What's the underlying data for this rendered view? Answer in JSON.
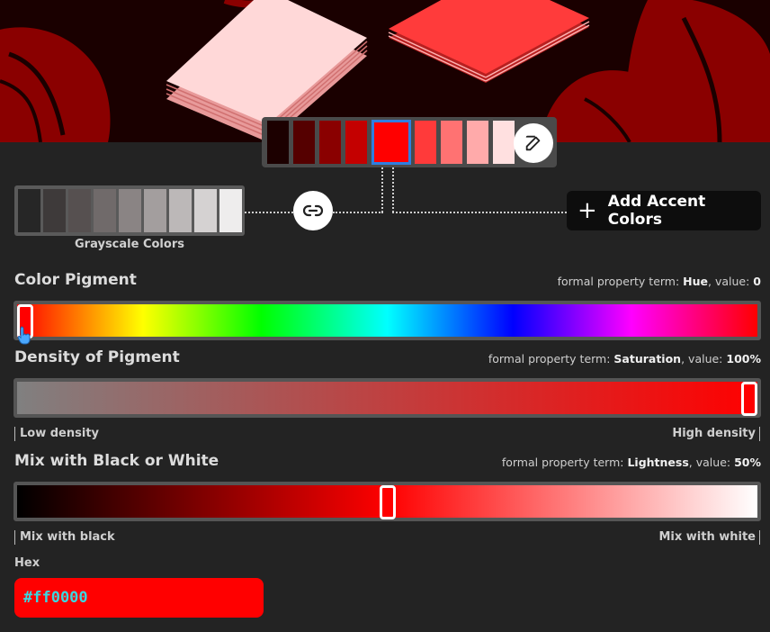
{
  "palette": {
    "swatches": [
      "#1c0000",
      "#550000",
      "#8a0000",
      "#c40000",
      "#ff0000",
      "#ff3a3a",
      "#ff7272",
      "#ffaaaa",
      "#ffe0e0"
    ],
    "selected_index": 4
  },
  "grayscale": {
    "label": "Grayscale Colors",
    "swatches": [
      "#262626",
      "#3e3a3a",
      "#565050",
      "#706a6a",
      "#8a8484",
      "#a39e9e",
      "#bcb8b8",
      "#d5d2d2",
      "#eeeded"
    ]
  },
  "accent_button": {
    "label": "Add Accent Colors"
  },
  "hue": {
    "title": "Color Pigment",
    "term_prefix": "formal property term: ",
    "term_name": "Hue",
    "value_sep": ", value: ",
    "value": "0",
    "level": 0
  },
  "saturation": {
    "title": "Density of Pigment",
    "term_prefix": "formal property term: ",
    "term_name": "Saturation",
    "value_sep": ", value: ",
    "value": "100%",
    "level": 1,
    "low_label": "Low density",
    "high_label": "High density"
  },
  "lightness": {
    "title": "Mix with Black or White",
    "term_prefix": "formal property term: ",
    "term_name": "Lightness",
    "value_sep": ", value: ",
    "value": "50%",
    "level": 0.5,
    "low_label": "Mix with black",
    "high_label": "Mix with white"
  },
  "hex": {
    "label": "Hex",
    "value": "#ff0000"
  },
  "icons": {
    "edit": "edit-icon",
    "link": "link-icon",
    "plus": "plus-icon",
    "pointer": "hand-pointer-icon"
  }
}
